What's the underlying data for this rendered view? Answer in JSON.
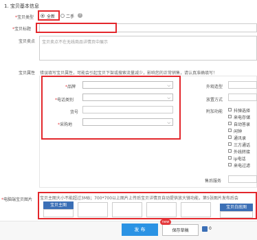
{
  "section_title": "1. 宝贝基本信息",
  "type_field": {
    "label": "宝贝类型",
    "opt_new": "全新",
    "opt_used": "二手"
  },
  "title_field": {
    "label": "宝贝标题",
    "value": ""
  },
  "selling_points": {
    "label": "宝贝卖点",
    "placeholder": "宝贝卖点不在无线商品详情页中展示"
  },
  "attributes": {
    "label": "宝贝属性",
    "hint": "错误填写宝贝属性，可能会引起宝贝下架或搜索流量减少，影响您的正常销售，请认真准确填写！",
    "brand": "品牌",
    "category": "电话类别",
    "model": "货号",
    "purchase": "采购地",
    "appearance": "外观造型",
    "placement": "放置方式",
    "extra": "附加功能",
    "extras": [
      "抖弹选择",
      "来电存储",
      "自动答录",
      "闲钟",
      "通讯录",
      "三方通话",
      "外线转接",
      "ip电话",
      "来电过滤"
    ],
    "after_sale": "售后服务"
  },
  "images": {
    "label": "电脑端宝贝图片",
    "hint": "宝贝主图大小不能超过3MB；700*700以上图片上传后宝贝详情页自动提供放大镜功能，第5张图片发布后会",
    "main_btn": "宝贝主图",
    "white_btn": "宝贝白底图"
  },
  "footer": {
    "publish": "发 布",
    "draft": "保存草稿",
    "new_badge": "new",
    "count": "0"
  }
}
